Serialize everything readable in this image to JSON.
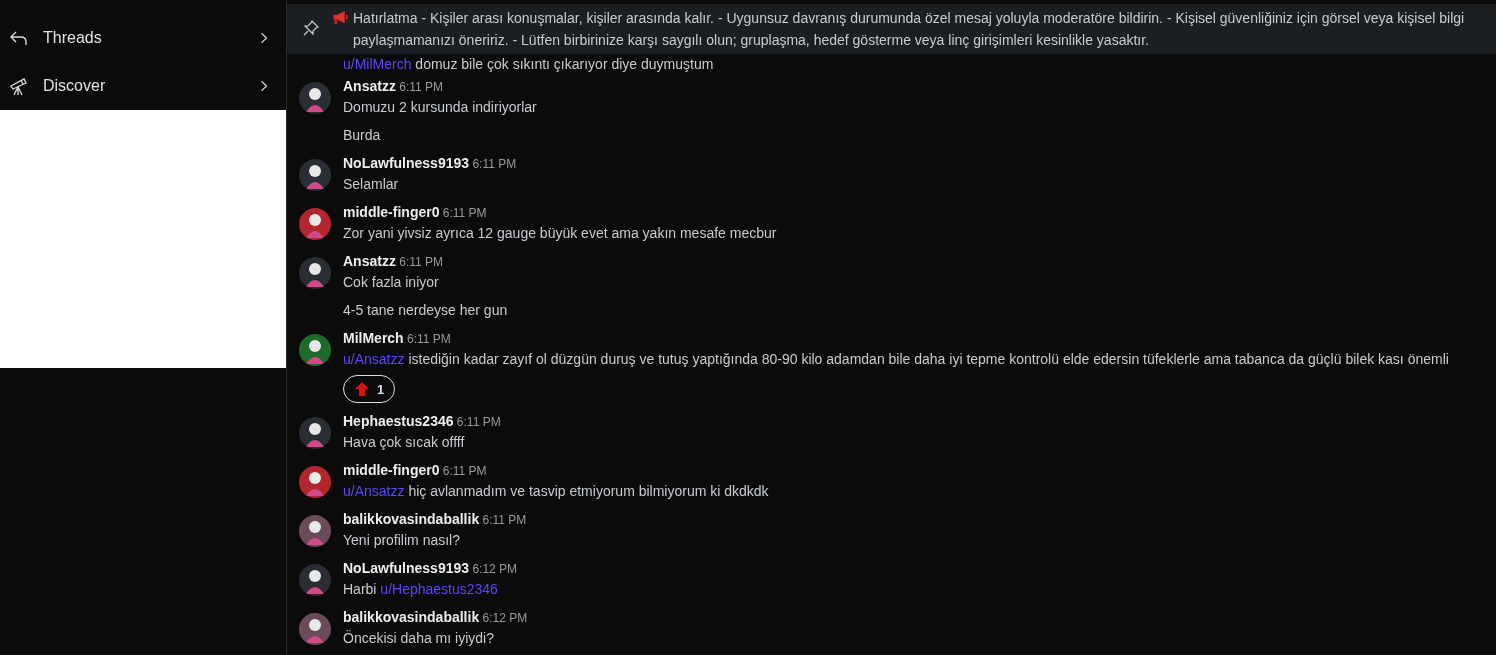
{
  "sidebar": {
    "items": [
      {
        "kind": "threads",
        "label": "Threads"
      },
      {
        "kind": "discover",
        "label": "Discover"
      }
    ]
  },
  "pinned_banner": {
    "text": "Hatırlatma - Kişiler arası konuşmalar, kişiler arasında kalır. - Uygunsuz davranış durumunda özel mesaj yoluyla moderatöre bildirin. - Kişisel güvenliğiniz için görsel veya kişisel bilgi paylaşmamanızı öneririz. - Lütfen birbirinize karşı saygılı olun; gruplaşma, hedef gösterme veya linç girişimleri kesinlikle yasaktır."
  },
  "messages": [
    {
      "bodies": [
        [
          {
            "kind": "mention",
            "text": "u/MilMerch"
          },
          {
            "kind": "text",
            "text": "domuz bile çok sıkıntı çıkarıyor diye duymuştum"
          }
        ]
      ]
    },
    {
      "user": "Ansatzz",
      "time": "6:11 PM",
      "color": "#2a2d33",
      "bodies": [
        [
          {
            "kind": "text",
            "text": "Domuzu 2 kursunda indiriyorlar"
          }
        ],
        [
          {
            "kind": "text",
            "text": "Burda"
          }
        ]
      ]
    },
    {
      "user": "NoLawfulness9193",
      "time": "6:11 PM",
      "color": "#2a2d33",
      "bodies": [
        [
          {
            "kind": "text",
            "text": "Selamlar"
          }
        ]
      ]
    },
    {
      "user": "middle-finger0",
      "time": "6:11 PM",
      "color": "#b3262e",
      "bodies": [
        [
          {
            "kind": "text",
            "text": "Zor yani yivsiz ayrıca 12 gauge büyük evet ama yakın mesafe mecbur"
          }
        ]
      ]
    },
    {
      "user": "Ansatzz",
      "time": "6:11 PM",
      "color": "#2a2d33",
      "bodies": [
        [
          {
            "kind": "text",
            "text": "Cok fazla iniyor"
          }
        ],
        [
          {
            "kind": "text",
            "text": "4-5 tane nerdeyse her gun"
          }
        ]
      ]
    },
    {
      "user": "MilMerch",
      "time": "6:11 PM",
      "color": "#1d6b2a",
      "bodies": [
        [
          {
            "kind": "mention",
            "text": "u/Ansatzz"
          },
          {
            "kind": "text",
            "text": "istediğin kadar zayıf ol düzgün duruş ve tutuş yaptığında 80-90 kilo adamdan bile daha iyi tepme kontrolü elde edersin tüfeklerle ama tabanca da güçlü bilek kası önemli"
          }
        ]
      ],
      "reaction": {
        "count": "1"
      }
    },
    {
      "user": "Hephaestus2346",
      "time": "6:11 PM",
      "color": "#2a2d33",
      "bodies": [
        [
          {
            "kind": "text",
            "text": "Hava çok sıcak offff"
          }
        ]
      ]
    },
    {
      "user": "middle-finger0",
      "time": "6:11 PM",
      "color": "#b3262e",
      "bodies": [
        [
          {
            "kind": "mention",
            "text": "u/Ansatzz"
          },
          {
            "kind": "text",
            "text": "hiç avlanmadım ve tasvip etmiyorum bilmiyorum ki dkdkdk"
          }
        ]
      ]
    },
    {
      "user": "balikkovasindaballik",
      "time": "6:11 PM",
      "color": "#6b4a5a",
      "bodies": [
        [
          {
            "kind": "text",
            "text": "Yeni profilim nasıl?"
          }
        ]
      ]
    },
    {
      "user": "NoLawfulness9193",
      "time": "6:12 PM",
      "color": "#2a2d33",
      "bodies": [
        [
          {
            "kind": "text",
            "text": "Harbi"
          },
          {
            "kind": "mention",
            "text": "u/Hephaestus2346"
          }
        ]
      ]
    },
    {
      "user": "balikkovasindaballik",
      "time": "6:12 PM",
      "color": "#6b4a5a",
      "bodies": [
        [
          {
            "kind": "text",
            "text": "Öncekisi daha mı iyiydi?"
          }
        ]
      ]
    }
  ]
}
